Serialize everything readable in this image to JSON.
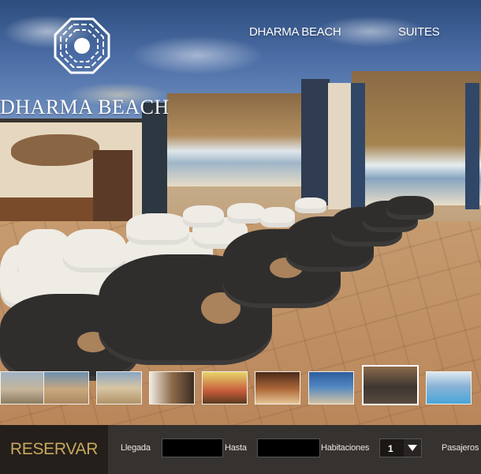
{
  "brand": {
    "name": "DHARMA BEACH",
    "logo_icon": "bagua-octagon-icon"
  },
  "nav": {
    "items": [
      {
        "label": "DHARMA BEACH"
      },
      {
        "label": "SUITES"
      }
    ]
  },
  "hero": {
    "image_icon": "beach-lounge-photo"
  },
  "thumbnails": {
    "count": 9,
    "active_index": 6,
    "icons": [
      "hotel-photo",
      "beach-photo",
      "beach-photo",
      "room-photo",
      "dining-photo",
      "dining-photo",
      "pool-photo",
      "lounge-photo",
      "pool-photo"
    ]
  },
  "booking": {
    "reserve_label": "RESERVAR",
    "arrival_label": "Llegada",
    "arrival_value": "",
    "until_label": "Hasta",
    "until_value": "",
    "rooms_label": "Habitaciones",
    "rooms_value": "1",
    "passengers_label": "Pasajeros"
  },
  "colors": {
    "reserve_text": "#c9a85c",
    "booking_bar": "#35322f",
    "reserve_bg": "#241f1b"
  }
}
